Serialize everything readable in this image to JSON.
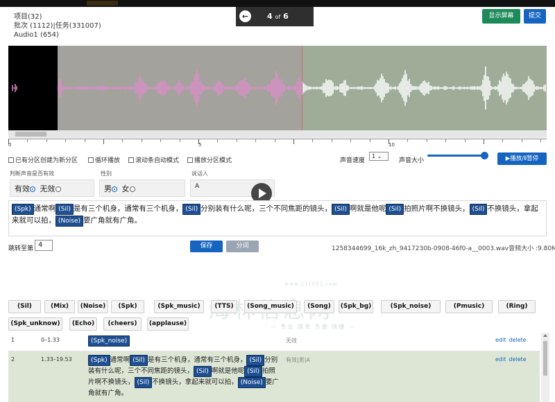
{
  "header": {
    "project": "项目(32)",
    "batch_task": "批次 (1112)|任务(331007)",
    "audio": "Audio1 (654)",
    "page_current": "4",
    "page_of": "of",
    "page_total": "6",
    "show_shortcuts": "显示屏幕",
    "submit": "提交"
  },
  "waveform": {
    "timeline_labels": [
      "0",
      "5",
      "10"
    ]
  },
  "options": {
    "auto_new_partition": "已有分区创建为新分区",
    "loop_play": "循环播放",
    "scroll_auto": "滚动条自动模式",
    "play_partition": "播放分区模式",
    "speed_label": "声音速度",
    "speed_value": "1",
    "volume_label": "声音大小",
    "play_pause": "▶播放/Ⅱ暂停"
  },
  "form": {
    "valid_label": "判断声音是否有效",
    "valid_yes": "有效",
    "valid_no": "无效",
    "gender_label": "性别",
    "gender_male": "男",
    "gender_female": "女",
    "speaker_label": "说话人",
    "speaker_value": "A"
  },
  "transcript": {
    "segments": [
      {
        "tag": "(Spk)"
      },
      {
        "text": "通常啊"
      },
      {
        "tag": "(Sil)"
      },
      {
        "text": "是有三个机身，通常有三个机身，"
      },
      {
        "tag": "(Sil)"
      },
      {
        "text": "分别装有什么呢，三个不同焦距的镜头，"
      },
      {
        "tag": "(Sil)"
      },
      {
        "text": "啊就是他呢"
      },
      {
        "tag": "(Sil)"
      },
      {
        "text": "拍照片啊不换镜头，"
      },
      {
        "tag": "(Sil)"
      },
      {
        "text": "不换镜头，拿起来就可以拍，"
      },
      {
        "tag": "(Noise)"
      },
      {
        "text": "要广角就有广角。"
      }
    ]
  },
  "actions": {
    "jump_label": "跳转至第",
    "jump_value": "4",
    "save": "保存",
    "split": "分词",
    "filename": "1258344699_16k_zh_9417230b-0908-46f0-a__0003.wav音频大小 :9.80M"
  },
  "watermark": {
    "main": "海林信息网",
    "url": "www.231083.com",
    "slogan": "— 专业 简单 方便 快捷 —"
  },
  "label_buttons": [
    "(Sil)",
    "(Mix)",
    "(Noise)",
    "(Spk)",
    "(Spk_music)",
    "(TTS)",
    "(Song_music)",
    "(Song)",
    "(Spk_bg)",
    "(Spk_noise)",
    "(Pmusic)",
    "(Ring)",
    "(Spk_unknow)",
    "(Echo)",
    "(cheers)",
    "(applause)"
  ],
  "table": {
    "rows": [
      {
        "index": "1",
        "time": "0–1.33",
        "status": "无效",
        "edit": "edit",
        "delete": "delete",
        "segments": [
          {
            "tag": "(Spk_noise)"
          }
        ]
      },
      {
        "index": "2",
        "time": "1.33–19.53",
        "status": "有效|男|A",
        "edit": "edit",
        "delete": "delete",
        "segments": [
          {
            "tag": "(Spk)"
          },
          {
            "text": "通常啊"
          },
          {
            "tag": "(Sil)"
          },
          {
            "text": "是有三个机身，通常有三个机身，"
          },
          {
            "tag": "(Sil)"
          },
          {
            "text": "分别装有什么呢，三个不同焦距的镜头，"
          },
          {
            "tag": "(Sil)"
          },
          {
            "text": "啊就是他呢"
          },
          {
            "tag": "(Sil)"
          },
          {
            "text": "拍照片啊不换镜头，"
          },
          {
            "tag": "(Sil)"
          },
          {
            "text": "不换镜头，拿起来就可以拍，"
          },
          {
            "tag": "(Noise)"
          },
          {
            "text": "要广角就有广角。"
          }
        ]
      }
    ]
  },
  "colors": {
    "primary_blue": "#1565c0",
    "tag_blue": "#1e4f91",
    "green": "#1e8a5a",
    "wave_bg": "#9eac98",
    "wave_pink": "#d98fc8",
    "wave_white": "#ffffff"
  }
}
